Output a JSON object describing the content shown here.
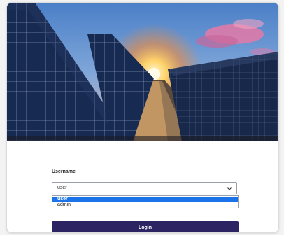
{
  "form": {
    "username_label": "Username",
    "username_value": "user",
    "options": [
      "user",
      "admin"
    ],
    "selected_index": 0,
    "login_label": "Login"
  },
  "colors": {
    "login_button": "#2c2362",
    "option_highlight": "#1a73e8"
  },
  "hero": {
    "image": "solar-panels-at-sunset"
  }
}
